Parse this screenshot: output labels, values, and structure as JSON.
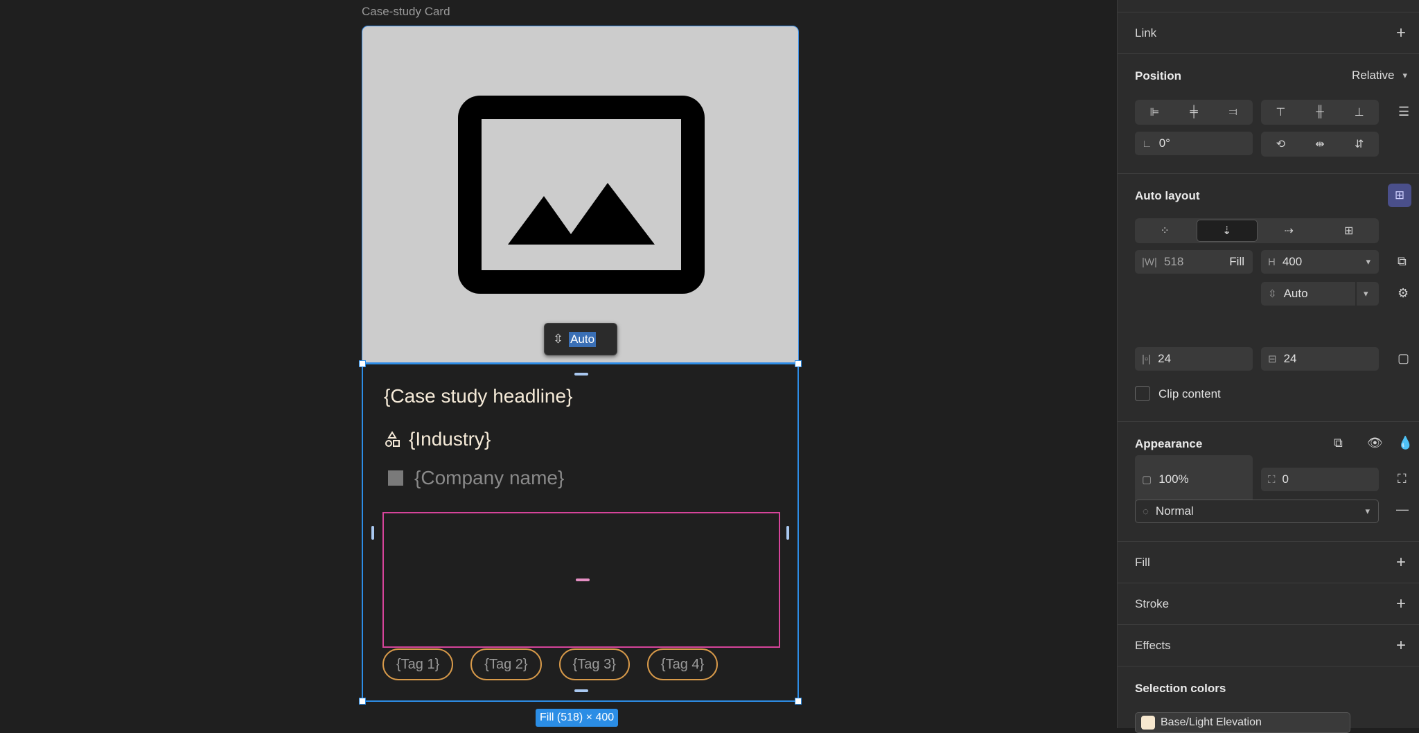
{
  "canvas": {
    "frame_label": "Case-study Card",
    "gap_chip": {
      "value": "Auto"
    },
    "card": {
      "headline": "{Case study headline}",
      "industry": "{Industry}",
      "company": "{Company name}",
      "tags": [
        "{Tag 1}",
        "{Tag 2}",
        "{Tag 3}",
        "{Tag 4}"
      ]
    },
    "size_badge": "Fill (518) × 400"
  },
  "panel": {
    "link": {
      "title": "Link"
    },
    "position": {
      "title": "Position",
      "mode": "Relative",
      "rotation": "0°"
    },
    "auto_layout": {
      "title": "Auto layout",
      "width_label": "|W|",
      "width_value": "518",
      "width_mode": "Fill",
      "height_label": "H",
      "height_value": "400",
      "gap_value": "Auto",
      "padding_h": "24",
      "padding_v": "24",
      "clip_label": "Clip content"
    },
    "appearance": {
      "title": "Appearance",
      "opacity": "100%",
      "radius": "0",
      "blend": "Normal"
    },
    "fill": {
      "title": "Fill"
    },
    "stroke": {
      "title": "Stroke"
    },
    "effects": {
      "title": "Effects"
    },
    "selection_colors": {
      "title": "Selection colors",
      "items": [
        {
          "name": "Base/Light Elevation",
          "color": "#f7e8cf"
        }
      ]
    }
  },
  "colors": {
    "selection_blue": "#2d8de6",
    "pink_outline": "#d6449a",
    "tag_outline": "#d89a4a",
    "accent_purple": "#a39bff"
  }
}
